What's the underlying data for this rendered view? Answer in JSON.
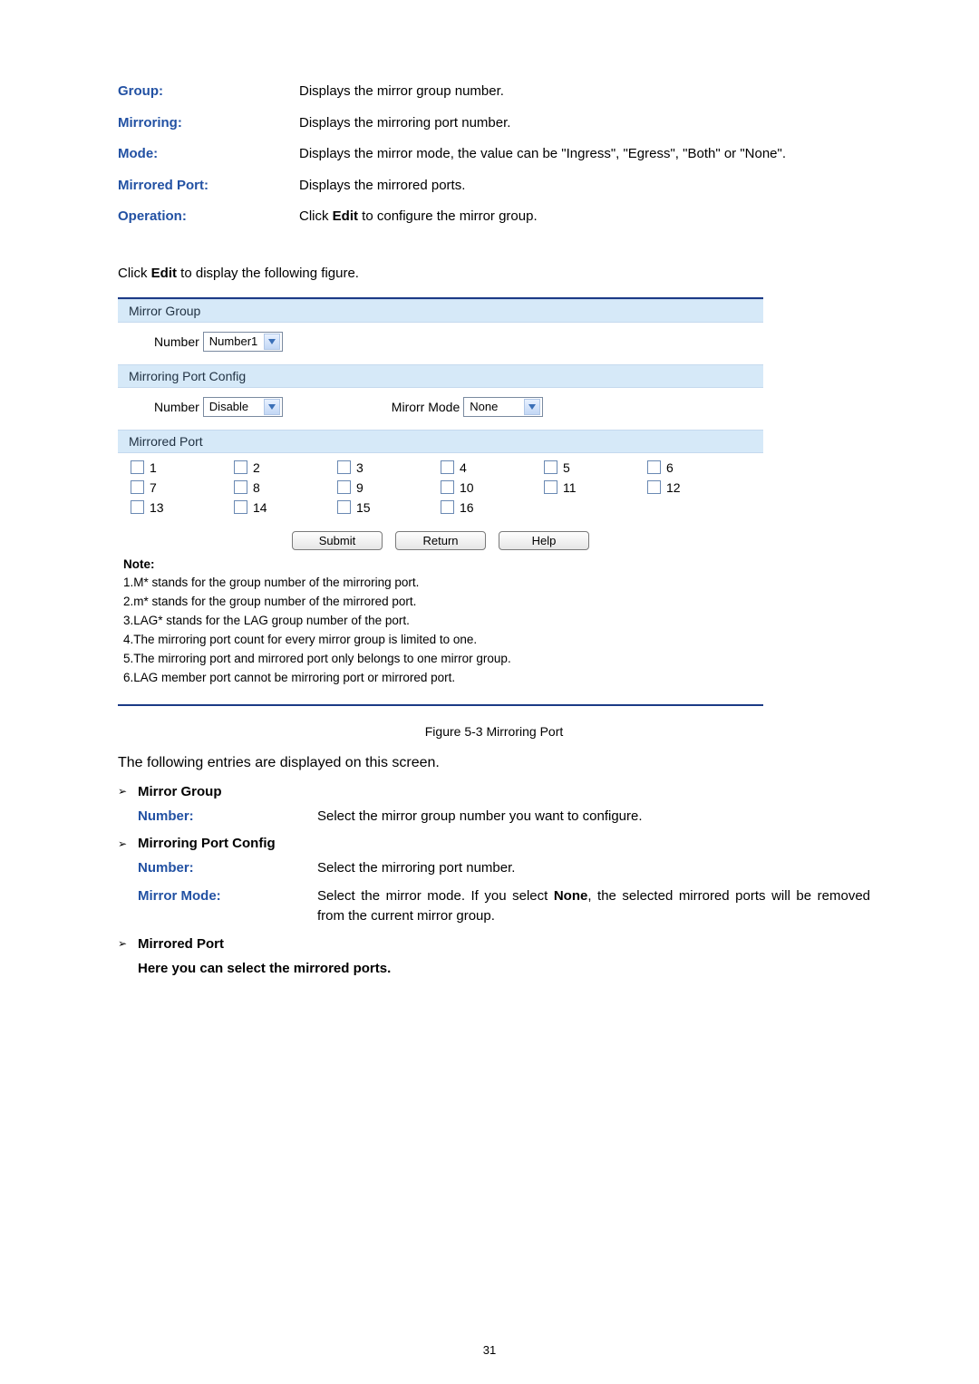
{
  "top_defs": [
    {
      "label": "Group:",
      "value": "Displays the mirror group number."
    },
    {
      "label": "Mirroring:",
      "value": "Displays the mirroring port number."
    },
    {
      "label": "Mode:",
      "value": "Displays the mirror mode, the value can be \"Ingress\", \"Egress\", \"Both\" or \"None\"."
    },
    {
      "label": "Mirrored Port:",
      "value": "Displays the mirrored ports."
    },
    {
      "label": "Operation:",
      "value_prefix": "Click ",
      "bold": "Edit",
      "value_suffix": " to configure the mirror group."
    }
  ],
  "click_edit_prefix": "Click ",
  "click_edit_bold": "Edit",
  "click_edit_suffix": " to display the following figure.",
  "panel": {
    "section1_title": "Mirror Group",
    "number_lbl": "Number",
    "number_val": "Number1",
    "section2_title": "Mirroring Port Config",
    "number2_val": "Disable",
    "mirror_mode_lbl": "Mirorr Mode",
    "mirror_mode_val": "None",
    "section3_title": "Mirrored Port",
    "ports": [
      "1",
      "2",
      "3",
      "4",
      "5",
      "6",
      "7",
      "8",
      "9",
      "10",
      "11",
      "12",
      "13",
      "14",
      "15",
      "16"
    ],
    "btn_submit": "Submit",
    "btn_return": "Return",
    "btn_help": "Help"
  },
  "notes_title": "Note:",
  "notes": [
    "1.M* stands for the group number of the mirroring port.",
    "2.m* stands for the group number of the mirrored port.",
    "3.LAG* stands for the LAG group number of the port.",
    "4.The mirroring port count for every mirror group is limited to one.",
    "5.The mirroring port and mirrored port only belongs to one mirror group.",
    "6.LAG member port cannot be mirroring port or mirrored port."
  ],
  "figure_caption": "Figure 5-3 Mirroring Port",
  "intro_line": "The following entries are displayed on this screen.",
  "entry_sections": {
    "s1_title": "Mirror Group",
    "s1_defs": [
      {
        "label": "Number:",
        "value": "Select the mirror group number you want to configure."
      }
    ],
    "s2_title": "Mirroring Port Config",
    "s2_defs": [
      {
        "label": "Number:",
        "value": "Select the mirroring port number."
      },
      {
        "label": "Mirror Mode:",
        "value_prefix": "Select the mirror mode. If you select ",
        "bold": "None",
        "value_suffix": ", the selected mirrored ports will be removed from the current mirror group."
      }
    ],
    "s3_title": "Mirrored Port",
    "s3_note": "Here you can select the mirrored ports."
  },
  "page_number": "31"
}
